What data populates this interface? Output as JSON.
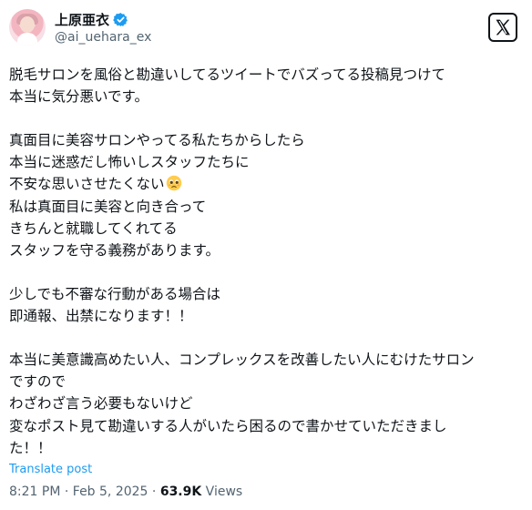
{
  "author": {
    "display_name": "上原亜衣",
    "handle": "@ai_uehara_ex",
    "verified": true,
    "verified_color": "#1d9bf0"
  },
  "icons": {
    "avatar": "profile-photo",
    "verified": "verified-badge-icon",
    "platform": "x-logo-icon",
    "emoji": "pleading-face-emoji"
  },
  "tweet": {
    "lines": [
      "脱毛サロンを風俗と勘違いしてるツイートでバズってる投稿見つけて",
      "本当に気分悪いです。",
      "",
      "真面目に美容サロンやってる私たちからしたら",
      "本当に迷惑だし怖いしスタッフたちに",
      "不安な思いさせたくない",
      "私は真面目に美容と向き合って",
      "きちんと就職してくれてる",
      "スタッフを守る義務があります。",
      "",
      "少しでも不審な行動がある場合は",
      "即通報、出禁になります！！",
      "",
      "本当に美意識高めたい人、コンプレックスを改善したい人にむけたサロン",
      "ですので",
      "わざわざ言う必要もないけど",
      "変なポスト見て勘違いする人がいたら困るので書かせていただきまし",
      "た！！"
    ]
  },
  "translate_label": "Translate post",
  "meta": {
    "time": "8:21 PM",
    "separator": " · ",
    "date": "Feb 5, 2025",
    "views_count": "63.9K",
    "views_label": "Views"
  },
  "colors": {
    "text": "#0f1419",
    "secondary": "#536471",
    "link": "#1d9bf0"
  }
}
